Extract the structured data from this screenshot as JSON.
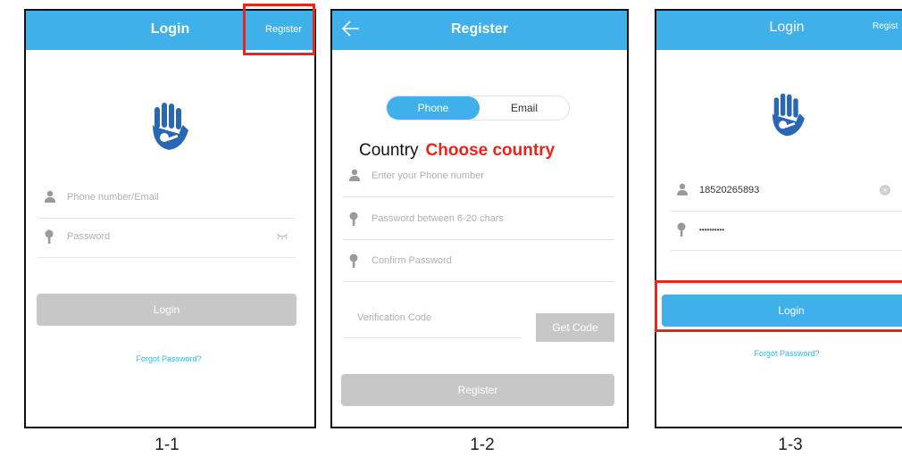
{
  "colors": {
    "accent": "#3fb0e9",
    "disabled": "#c7c7c7",
    "highlight": "#e8261c",
    "logo": "#2966b3"
  },
  "screen1": {
    "title": "Login",
    "register_label": "Register",
    "account_placeholder": "Phone number/Email",
    "password_placeholder": "Password",
    "login_label": "Login",
    "forgot_label": "Forgot Password?"
  },
  "screen2": {
    "title": "Register",
    "tabs": [
      "Phone",
      "Email"
    ],
    "country_label": "Country",
    "country_value": "Choose country",
    "phone_placeholder": "Enter your Phone number",
    "password_placeholder": "Password between 6-20 chars",
    "confirm_placeholder": "Confirm Password",
    "verification_placeholder": "Verification Code",
    "get_code_label": "Get Code",
    "register_label": "Register"
  },
  "screen3": {
    "title": "Login",
    "register_label": "Regist",
    "account_value": "18520265893",
    "password_value": "••••••••••",
    "login_label": "Login",
    "forgot_label": "Forgot Password?"
  },
  "captions": [
    "1-1",
    "1-2",
    "1-3"
  ],
  "icons": {
    "logo": "hand-key-icon",
    "user": "user-icon",
    "key": "key-icon",
    "eye": "eye-closed-icon",
    "back": "back-arrow-icon",
    "clear": "clear-icon"
  }
}
